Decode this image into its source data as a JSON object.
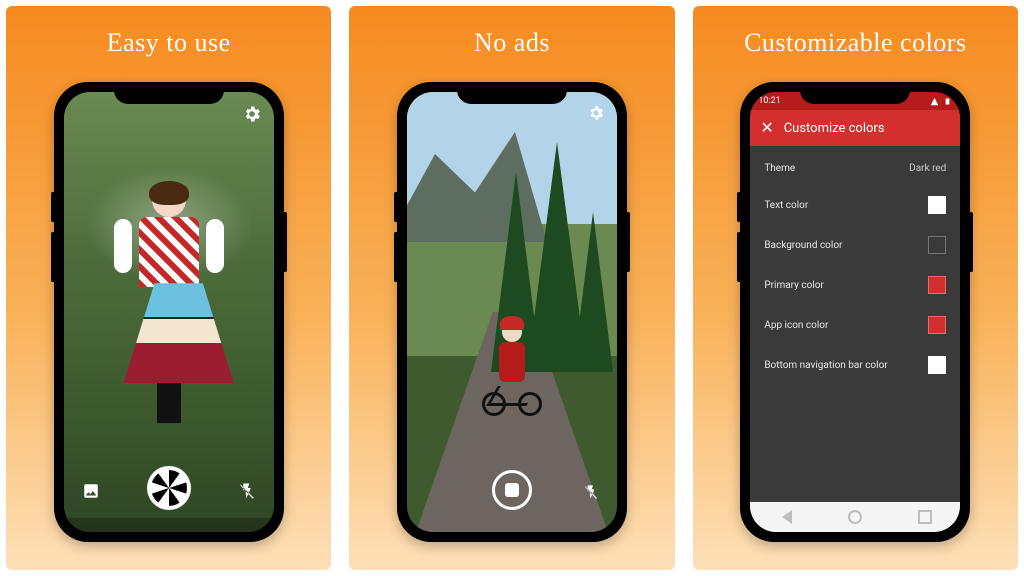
{
  "panels": [
    {
      "title": "Easy to use"
    },
    {
      "title": "No ads"
    },
    {
      "title": "Customizable colors"
    }
  ],
  "statusbar": {
    "time": "10:21"
  },
  "customize": {
    "header": "Customize colors",
    "rows": {
      "theme": {
        "label": "Theme",
        "value": "Dark red"
      },
      "text": {
        "label": "Text color"
      },
      "bg": {
        "label": "Background color"
      },
      "primary": {
        "label": "Primary color"
      },
      "appicon": {
        "label": "App icon color"
      },
      "navbar": {
        "label": "Bottom navigation bar color"
      }
    }
  },
  "colors": {
    "accent": "#d32f2f",
    "panel_bg_top": "#f58a1f",
    "panel_bg_bottom": "#fde0b8"
  }
}
